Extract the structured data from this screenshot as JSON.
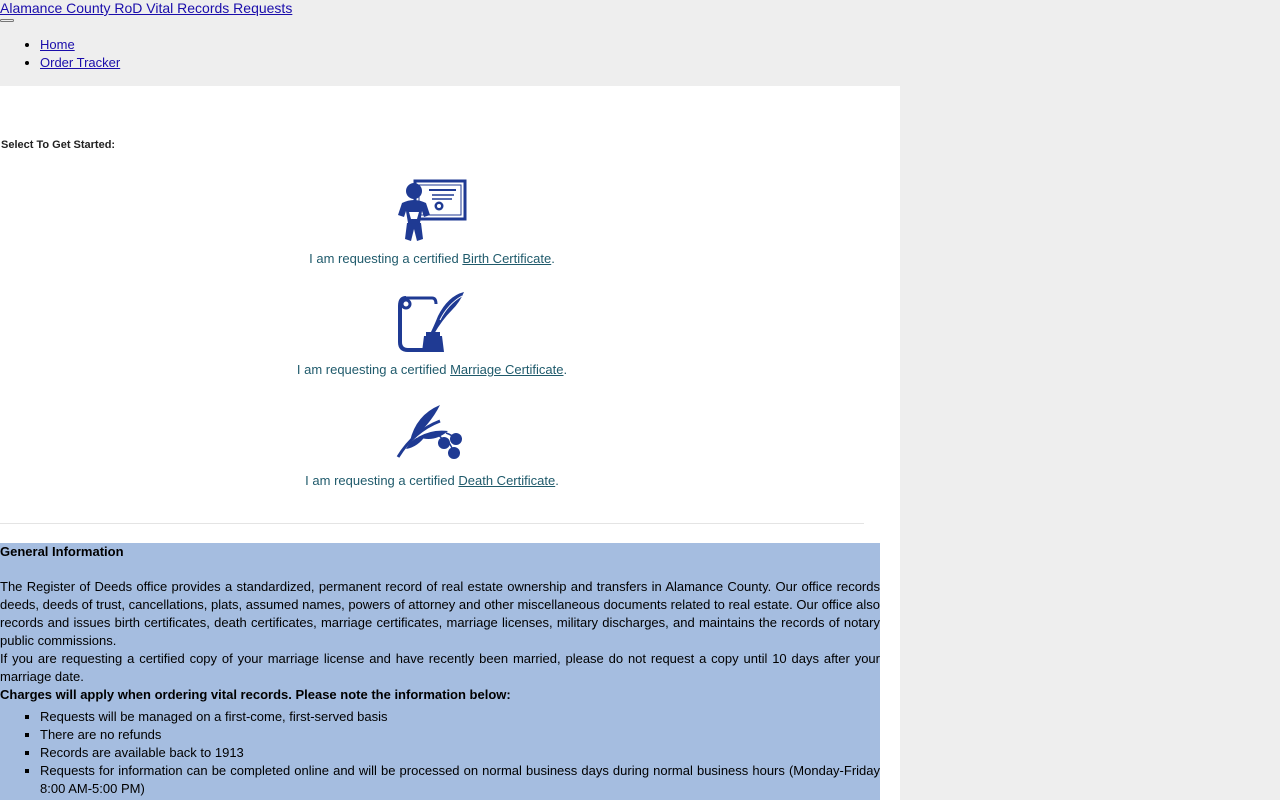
{
  "header": {
    "site_title": "Alamance County RoD Vital Records Requests",
    "nav": [
      {
        "label": "Home"
      },
      {
        "label": "Order Tracker"
      }
    ]
  },
  "start": {
    "label": "Select To Get Started:"
  },
  "options": [
    {
      "icon": "baby-certificate-icon",
      "prefix": "I am requesting a certified ",
      "link": "Birth Certificate",
      "suffix": "."
    },
    {
      "icon": "quill-scroll-icon",
      "prefix": "I am requesting a certified ",
      "link": "Marriage Certificate",
      "suffix": "."
    },
    {
      "icon": "olive-branch-icon",
      "prefix": "I am requesting a certified ",
      "link": "Death Certificate",
      "suffix": "."
    }
  ],
  "info": {
    "heading": "General Information",
    "para1": "The Register of Deeds office provides a standardized, permanent record of real estate ownership and transfers in Alamance County. Our office records deeds, deeds of trust, cancellations, plats, assumed names, powers of attorney and other miscellaneous documents related to real estate. Our office also records and issues birth certificates, death certificates, marriage certificates, marriage licenses, military discharges, and maintains the records of notary public commissions.",
    "para2": "If you are requesting a certified copy of your marriage license and have recently been married, please do not request a copy until 10 days after your marriage date.",
    "charges": "Charges will apply when ordering vital records. Please note the information below:",
    "items": [
      "Requests will be managed on a first-come, first-served basis",
      "There are no refunds",
      "Records are available back to 1913",
      "Requests for information can be completed online and will be processed on normal business days during normal business hours (Monday-Friday 8:00 AM-5:00 PM)"
    ]
  },
  "colors": {
    "icon_blue": "#1f3a93",
    "info_bg": "#a5bde0",
    "link_teal": "#1f5a6b"
  }
}
